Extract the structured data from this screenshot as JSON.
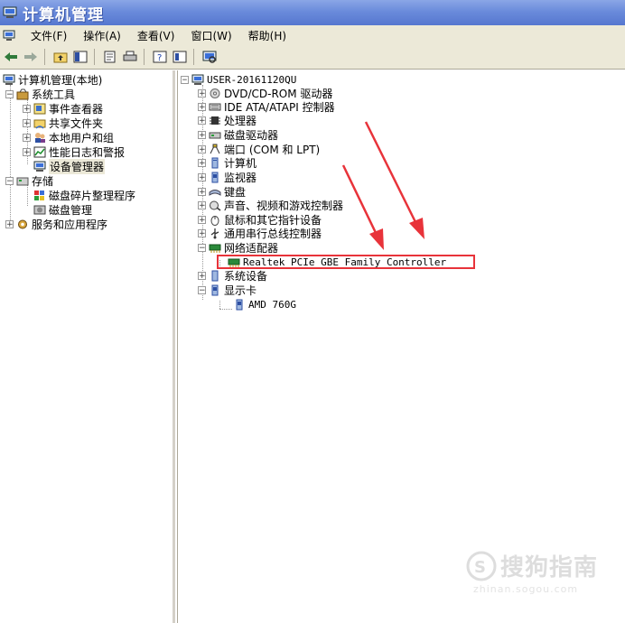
{
  "window": {
    "title": "计算机管理"
  },
  "menu": [
    "文件(F)",
    "操作(A)",
    "查看(V)",
    "窗口(W)",
    "帮助(H)"
  ],
  "toolbar": {
    "buttons": [
      "back-icon",
      "forward-icon",
      "up-folder-icon",
      "show-hide-tree-icon",
      "properties-icon",
      "print-icon",
      "help-icon",
      "help-topics-icon",
      "scan-hardware-icon"
    ]
  },
  "left_tree": {
    "root": "计算机管理(本地)",
    "system_tools": "系统工具",
    "event_viewer": "事件查看器",
    "shared_folders": "共享文件夹",
    "local_users": "本地用户和组",
    "perf_logs": "性能日志和警报",
    "device_manager": "设备管理器",
    "storage": "存储",
    "defrag": "磁盘碎片整理程序",
    "disk_mgmt": "磁盘管理",
    "services_apps": "服务和应用程序"
  },
  "device_tree": {
    "computer_name": "USER-20161120QU",
    "categories": [
      "DVD/CD-ROM 驱动器",
      "IDE ATA/ATAPI 控制器",
      "处理器",
      "磁盘驱动器",
      "端口 (COM 和 LPT)",
      "计算机",
      "监视器",
      "键盘",
      "声音、视频和游戏控制器",
      "鼠标和其它指针设备",
      "通用串行总线控制器",
      "网络适配器"
    ],
    "network_adapter_child": "Realtek PCIe GBE Family Controller",
    "system_devices": "系统设备",
    "display_adapters": "显示卡",
    "display_child": "AMD 760G"
  },
  "annotation": {
    "color": "#e8333a"
  },
  "watermark": {
    "main": "搜狗指南",
    "sub": "zhinan.sogou.com"
  },
  "colors": {
    "titlebar": "#6a8bdb",
    "chrome": "#ece9d8"
  }
}
